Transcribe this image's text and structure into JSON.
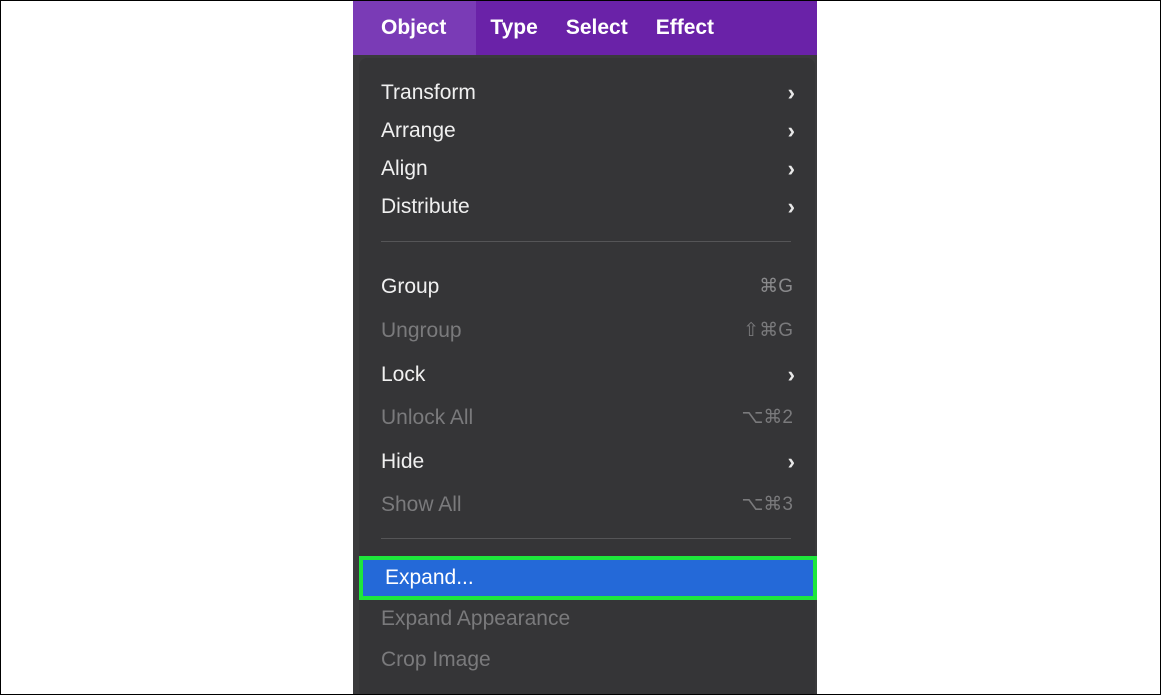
{
  "menubar": {
    "items": [
      {
        "label": "Object",
        "active": true
      },
      {
        "label": "Type"
      },
      {
        "label": "Select"
      },
      {
        "label": "Effect"
      }
    ]
  },
  "menu": {
    "transform": {
      "label": "Transform",
      "submenu": "›"
    },
    "arrange": {
      "label": "Arrange",
      "submenu": "›"
    },
    "align": {
      "label": "Align",
      "submenu": "›"
    },
    "distribute": {
      "label": "Distribute",
      "submenu": "›"
    },
    "group": {
      "label": "Group",
      "shortcut": "⌘G"
    },
    "ungroup": {
      "label": "Ungroup",
      "shortcut": "⇧⌘G"
    },
    "lock": {
      "label": "Lock",
      "submenu": "›"
    },
    "unlock_all": {
      "label": "Unlock All",
      "shortcut": "⌥⌘2"
    },
    "hide": {
      "label": "Hide",
      "submenu": "›"
    },
    "show_all": {
      "label": "Show All",
      "shortcut": "⌥⌘3"
    },
    "expand": {
      "label": "Expand..."
    },
    "expand_appearance": {
      "label": "Expand Appearance"
    },
    "crop_image": {
      "label": "Crop Image"
    }
  },
  "colors": {
    "menubar_bg": "#6a22a8",
    "menu_bg": "#353537",
    "selection": "#2469d8",
    "highlight_border": "#1ee63c"
  }
}
